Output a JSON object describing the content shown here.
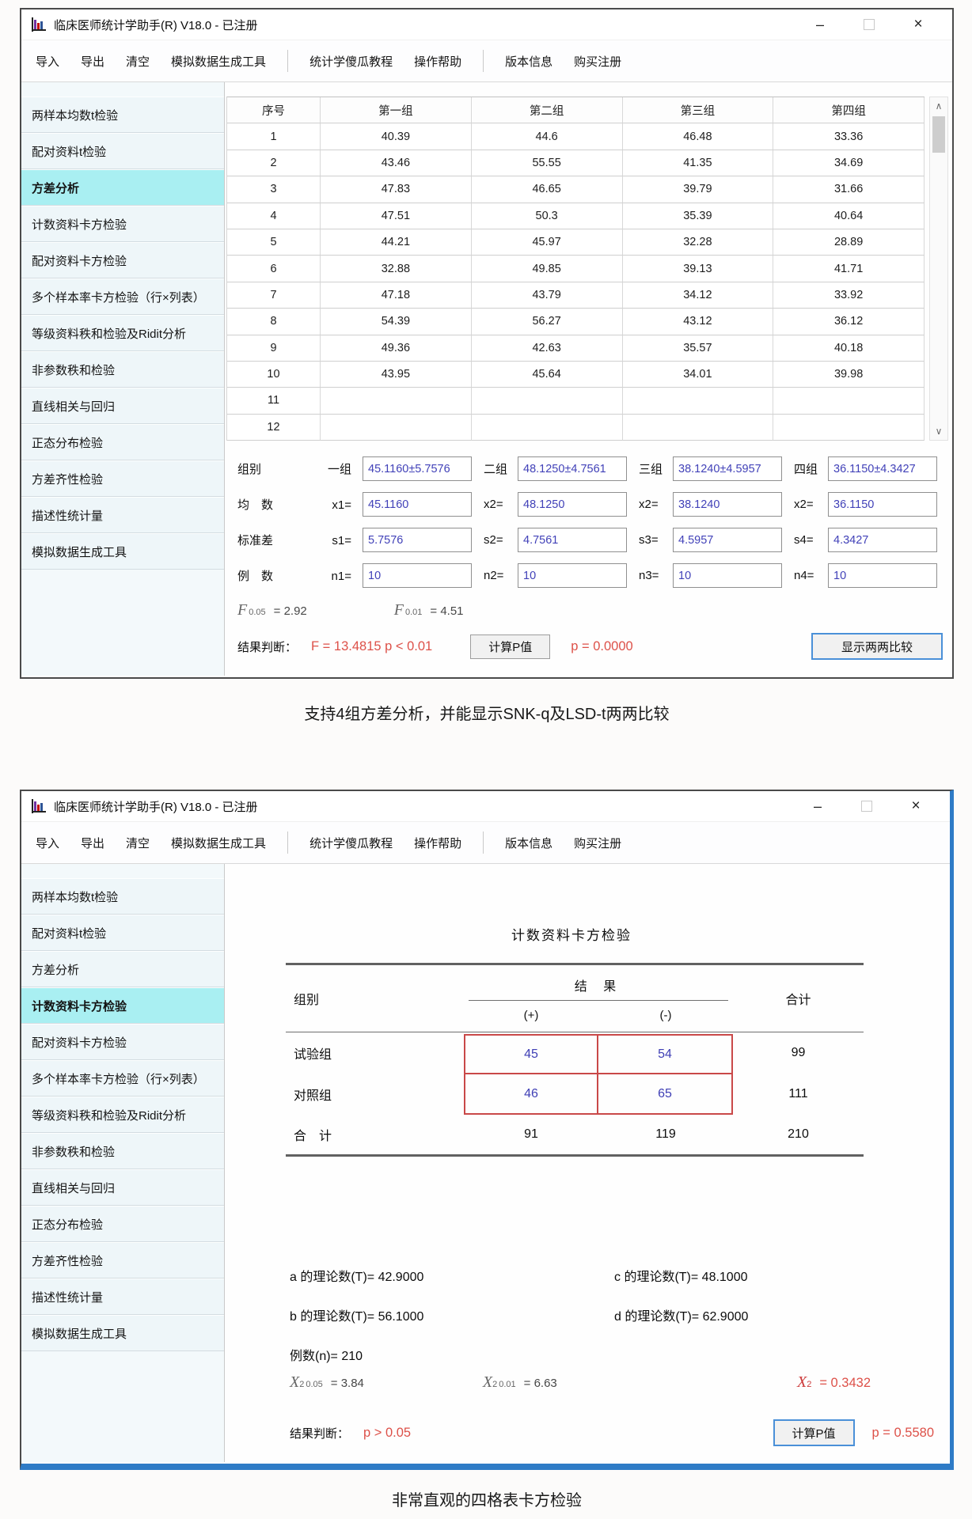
{
  "app": {
    "icon": "bar-chart-icon",
    "controls": {
      "minimize": "–",
      "close": "×"
    }
  },
  "menu": {
    "items": [
      "导入",
      "导出",
      "清空",
      "模拟数据生成工具",
      "统计学傻瓜教程",
      "操作帮助",
      "版本信息",
      "购买注册"
    ],
    "separators_after": [
      3,
      5
    ]
  },
  "sidebar_items": [
    "两样本均数t检验",
    "配对资料t检验",
    "方差分析",
    "计数资料卡方检验",
    "配对资料卡方检验",
    "多个样本率卡方检验（行×列表）",
    "等级资料秩和检验及Ridit分析",
    "非参数秩和检验",
    "直线相关与回归",
    "正态分布检验",
    "方差齐性检验",
    "描述性统计量",
    "模拟数据生成工具"
  ],
  "caption1": "支持4组方差分析，并能显示SNK-q及LSD-t两两比较",
  "caption2": "非常直观的四格表卡方检验",
  "window1": {
    "title": "临床医师统计学助手(R) V18.0 - 已注册",
    "active_sidebar": "方差分析",
    "table": {
      "headers": [
        "序号",
        "第一组",
        "第二组",
        "第三组",
        "第四组"
      ],
      "scroll_up": "∧",
      "scroll_down": "∨",
      "rows": [
        [
          "1",
          "40.39",
          "44.6",
          "46.48",
          "33.36"
        ],
        [
          "2",
          "43.46",
          "55.55",
          "41.35",
          "34.69"
        ],
        [
          "3",
          "47.83",
          "46.65",
          "39.79",
          "31.66"
        ],
        [
          "4",
          "47.51",
          "50.3",
          "35.39",
          "40.64"
        ],
        [
          "5",
          "44.21",
          "45.97",
          "32.28",
          "28.89"
        ],
        [
          "6",
          "32.88",
          "49.85",
          "39.13",
          "41.71"
        ],
        [
          "7",
          "47.18",
          "43.79",
          "34.12",
          "33.92"
        ],
        [
          "8",
          "54.39",
          "56.27",
          "43.12",
          "36.12"
        ],
        [
          "9",
          "49.36",
          "42.63",
          "35.57",
          "40.18"
        ],
        [
          "10",
          "43.95",
          "45.64",
          "34.01",
          "39.98"
        ],
        [
          "11",
          "",
          "",
          "",
          ""
        ],
        [
          "12",
          "",
          "",
          "",
          ""
        ]
      ]
    },
    "stats": {
      "rows": [
        {
          "head": "组别",
          "head2": "一组",
          "fields": [
            {
              "label": "",
              "value": "45.1160±5.7576"
            },
            {
              "label": "二组",
              "value": "48.1250±4.7561"
            },
            {
              "label": "三组",
              "value": "38.1240±4.5957"
            },
            {
              "label": "四组",
              "value": "36.1150±4.3427"
            }
          ]
        },
        {
          "head": "均　数",
          "head2": "x1=",
          "fields": [
            {
              "label": "",
              "value": "45.1160"
            },
            {
              "label": "x2=",
              "value": "48.1250"
            },
            {
              "label": "x2=",
              "value": "38.1240"
            },
            {
              "label": "x2=",
              "value": "36.1150"
            }
          ]
        },
        {
          "head": "标准差",
          "head2": "s1=",
          "fields": [
            {
              "label": "",
              "value": "5.7576"
            },
            {
              "label": "s2=",
              "value": "4.7561"
            },
            {
              "label": "s3=",
              "value": "4.5957"
            },
            {
              "label": "s4=",
              "value": "4.3427"
            }
          ]
        },
        {
          "head": "例　数",
          "head2": "n1=",
          "fields": [
            {
              "label": "",
              "value": "10"
            },
            {
              "label": "n2=",
              "value": "10"
            },
            {
              "label": "n3=",
              "value": "10"
            },
            {
              "label": "n4=",
              "value": "10"
            }
          ]
        }
      ],
      "f_crit": [
        {
          "sym": "F",
          "sub": "0.05",
          "val": "=  2.92"
        },
        {
          "sym": "F",
          "sub": "0.01",
          "val": "=  4.51"
        }
      ],
      "result_label": "结果判断：",
      "result_value": "F = 13.4815  p < 0.01",
      "calc_button": "计算P值",
      "p_value": "p = 0.0000",
      "compare_button": "显示两两比较"
    }
  },
  "window2": {
    "title": "临床医师统计学助手(R) V18.0 - 已注册",
    "active_sidebar": "计数资料卡方检验",
    "chi": {
      "heading": "计数资料卡方检验",
      "col_group": "组别",
      "col_result": "结  果",
      "col_plus": "(+)",
      "col_minus": "(-)",
      "col_total": "合计",
      "rows": [
        {
          "label": "试验组",
          "plus": "45",
          "minus": "54",
          "total": "99"
        },
        {
          "label": "对照组",
          "plus": "46",
          "minus": "65",
          "total": "111"
        },
        {
          "label": "合　计",
          "plus": "91",
          "minus": "119",
          "total": "210"
        }
      ],
      "theory": [
        "a 的理论数(T)= 42.9000",
        "c 的理论数(T)= 48.1000",
        "b 的理论数(T)= 56.1000",
        "d 的理论数(T)= 62.9000"
      ],
      "n_label": "例数(n)=  210",
      "chi_crit": [
        {
          "sym": "X",
          "sup": "2",
          "sub": "0.05",
          "val": "= 3.84"
        },
        {
          "sym": "X",
          "sup": "2",
          "sub": "0.01",
          "val": "= 6.63"
        }
      ],
      "chi_result": {
        "sym": "X",
        "sup": "2",
        "val": "=  0.3432"
      },
      "result_label": "结果判断：",
      "result_value": "p > 0.05",
      "calc_button": "计算P值",
      "p_value": "p = 0.5580"
    }
  }
}
